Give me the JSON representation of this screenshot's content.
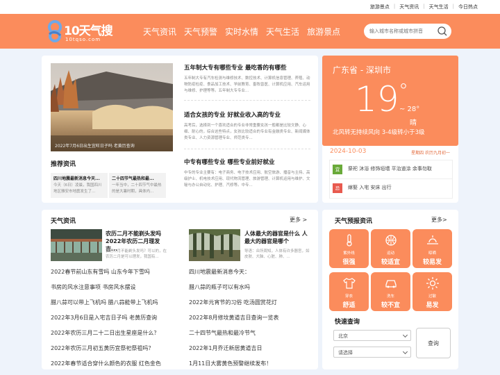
{
  "topbar": {
    "links": [
      "旅游景点",
      "天气资讯",
      "天气生活",
      "今日热点"
    ]
  },
  "logo": {
    "name": "10天气搜",
    "domain": "10tqso.com"
  },
  "nav": [
    "天气资讯",
    "天气预警",
    "实时水情",
    "天气生活",
    "旅游景点"
  ],
  "search": {
    "placeholder": "输入城市名称或城市拼音"
  },
  "news": {
    "image_caption": "2022年7月6日出生宜旺日子吗 老黄历查询",
    "items": [
      {
        "title": "五年制大专有哪些专业 最吃香的有哪些",
        "desc": "五年制大专有汽车检测与维修技术、数控技术、计算机信息管理、养殖、动物防疫检疫、食品加工技术、学前教育、畜牧兽医、计算机应用、汽车运用与维修、护理等等。五年制大专专业..."
      },
      {
        "title": "适合女孩的专业 好就业收入高的专业",
        "desc": "高考后，选择到一个喜欢适合的专业非常重要女孩一般都是比较文静、心细、耐心的，综合这些特点，女孩比较适合的专业有金融类专业、新闻媒体类专业、人力资源管理专业、师范类专..."
      },
      {
        "title": "中专有哪些专业 哪些专业前好就业",
        "desc": "中专的专业主要有：电子商务、电子技术应用、航空旅游、播音与主持、高级护士、机电技术应用、现代物流管理、旅游管理、计算机运用与维护、文秘与办公自动化、护理、汽修等。中专..."
      }
    ]
  },
  "recommended": {
    "title": "推荐资讯",
    "items": [
      {
        "title": "四川地震最新消息今天...",
        "desc": "今天（6日）凌晨，我国四川地区雅安市地震发生了..."
      },
      {
        "title": "二十四节气最热和最...",
        "desc": "一年当中，二十四节气中最热的是大暑时期，具体内..."
      }
    ]
  },
  "weather": {
    "location": "广东省 - 深圳市",
    "temp": "19",
    "deg": "°",
    "low": "~ 28°",
    "condition": "晴",
    "wind": "北风转无持续风向  3-4级转小于3级",
    "date": "2024-10-03",
    "lunar": "星期四  农历九月初一",
    "yi": {
      "badge": "宜",
      "text": "祭祀 沐浴 修饰垣墙 平治道涂 余事勿取"
    },
    "ji": {
      "badge": "忌",
      "text": "嫁娶 入宅 安床 出行"
    }
  },
  "weather_news": {
    "title": "天气资讯",
    "more": "更多 >",
    "featured": [
      {
        "title": "农历二月不能剃头发吗 2022年农历二月理发吉...",
        "desc": "农历二月不能剃头发吗？可以的，在农历二月是可以理发，我国有..."
      },
      {
        "title": "人体最大的器官是什么 人最大的器官是哪个",
        "desc": "导语：众所周知，人体有许多器官，如皮肤、大脑、心脏、肺、..."
      }
    ],
    "left_links": [
      "2022春节前山东有雪吗 山东今年下雪吗",
      "书房的风水注意事项 书房风水摆设",
      "腊八蒜可以带上飞机吗 腊八蒜能带上飞机吗",
      "2022年3月6日是入宅吉日子吗 老黄历查询",
      "2022年农历三月二十二日出生星座是什么？",
      "2022年农历三月初五黄历宜祭祀祭祖吗？",
      "2022年春节适合穿什么颜色的衣服 红色金色"
    ],
    "right_links": [
      "四川地震最新消息今天：",
      "腊八蒜的瓶子可以有水吗",
      "2022年元宵节的习俗 吃汤圆赏花灯",
      "2022年8月修坟黄道吉日查询一览表",
      "二十四节气最热和最冷节气",
      "2022年1月乔迁新居黄道吉日",
      "1月11日大雾黄色预警继续发布！"
    ]
  },
  "forecast": {
    "title": "天气预报资讯",
    "more": "更多>",
    "tiles": [
      {
        "icon": "thermometer-icon",
        "label": "紫外线",
        "value": "很强"
      },
      {
        "icon": "basketball-icon",
        "label": "运动",
        "value": "较适宜"
      },
      {
        "icon": "sun-horizon-icon",
        "label": "晾晒",
        "value": "较易发"
      },
      {
        "icon": "shirt-icon",
        "label": "穿衣",
        "value": "舒适"
      },
      {
        "icon": "car-icon",
        "label": "洗车",
        "value": "较不宜"
      },
      {
        "icon": "sun-icon",
        "label": "过敏",
        "value": "易发"
      }
    ]
  },
  "quick_search": {
    "title": "快速查询",
    "province": "北京",
    "city": "请选择",
    "button": "查询"
  },
  "colors": {
    "accent": "#fb8c5c",
    "page_bg": "#eef3fb",
    "yi": "#6aaa3a",
    "ji": "#e85a4f"
  }
}
